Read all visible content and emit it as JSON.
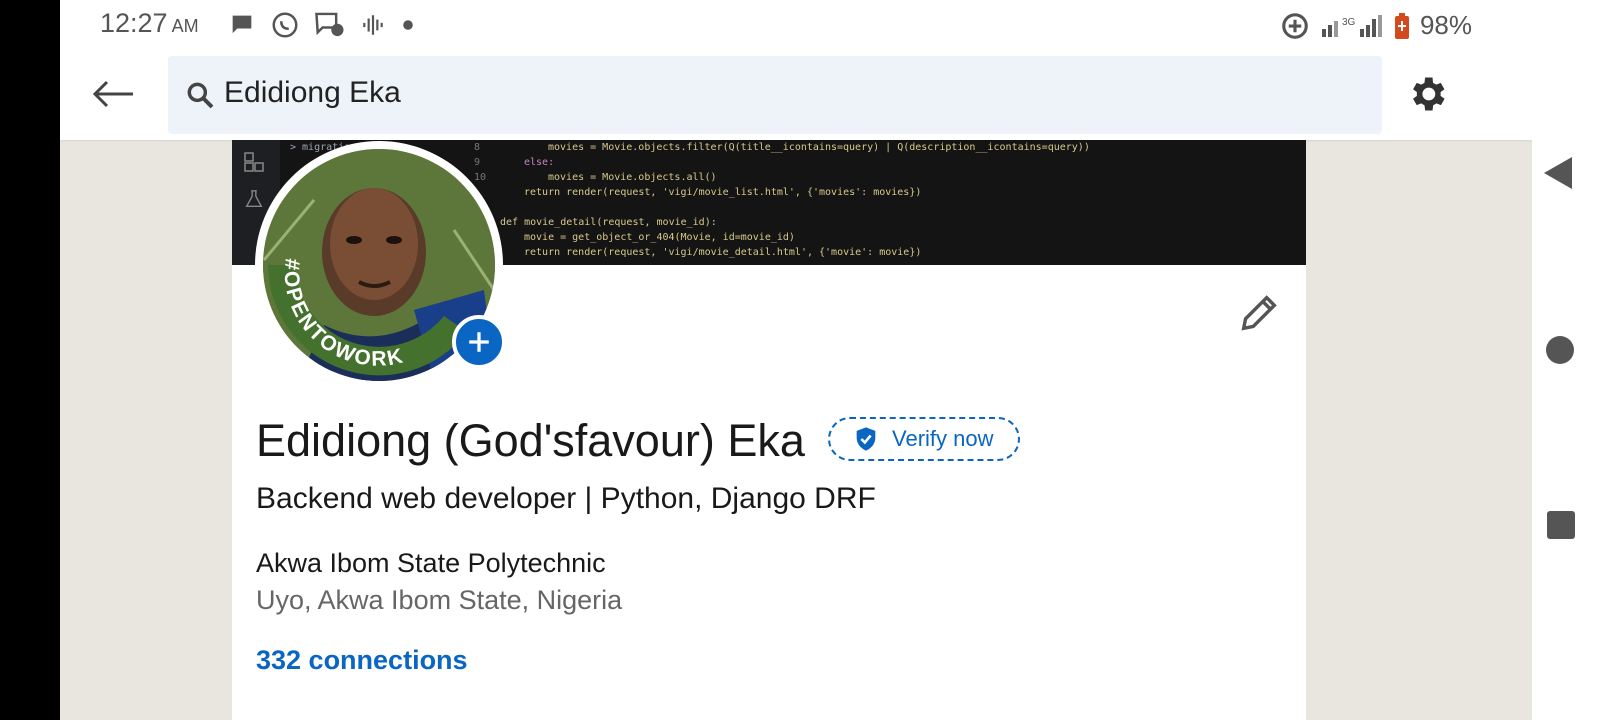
{
  "status": {
    "time": "12:27",
    "ampm": "AM",
    "battery": "98%",
    "network": "3G"
  },
  "search": {
    "value": "Edidiong Eka"
  },
  "profile": {
    "name": "Edidiong (God'sfavour) Eka",
    "verify_label": "Verify now",
    "headline": "Backend web developer | Python, Django DRF",
    "school": "Akwa Ibom State Polytechnic",
    "location": "Uyo, Akwa Ibom State, Nigeria",
    "connections": "332 connections",
    "open_to_work_badge": "#OPENTOWORK"
  },
  "banner_code": [
    "> migrations",
    "movies = Movie.objects.filter(Q(title__icontains=query) | Q(description__icontains=query))",
    "else:",
    "movies = Movie.objects.all()",
    "return render(request, 'vigi/movie_list.html', {'movies': movies})",
    "def movie_detail(request, movie_id):",
    "movie = get_object_or_404(Movie, id=movie_id)",
    "return render(request, 'vigi/movie_detail.html', {'movie': movie})"
  ],
  "banner_line_numbers": [
    "8",
    "9",
    "10"
  ],
  "colors": {
    "accent": "#0a66c2",
    "open_to_work_ring": "#44712e",
    "page_bg": "#e9e5df",
    "search_bg": "#edf3f8"
  },
  "icons": {
    "back": "arrow-left-icon",
    "search": "search-icon",
    "settings": "gear-icon",
    "edit": "pencil-icon",
    "verify": "shield-check-icon",
    "add_photo": "plus-icon",
    "nav_back": "triangle-back-icon",
    "nav_home": "circle-home-icon",
    "nav_recents": "square-recents-icon"
  }
}
